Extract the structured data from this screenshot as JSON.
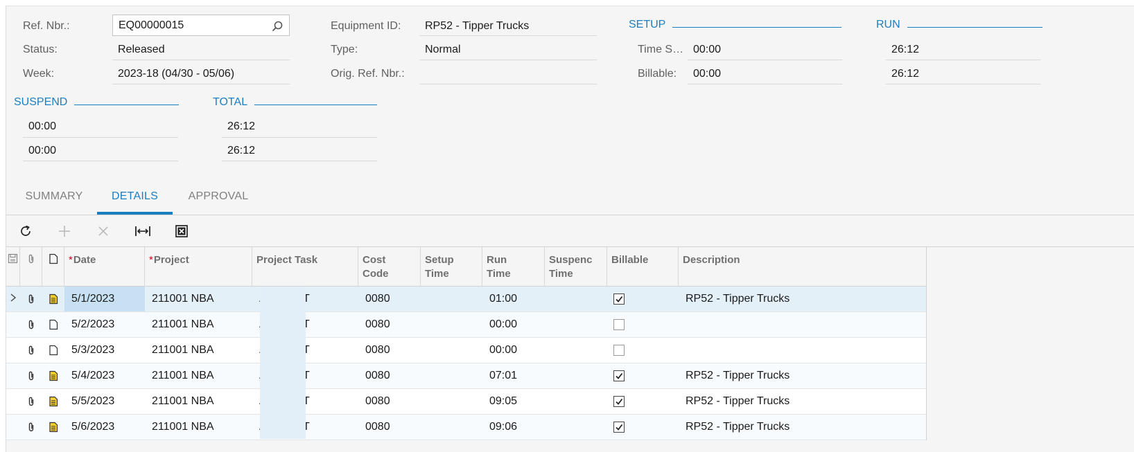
{
  "header": {
    "ref_nbr_label": "Ref. Nbr.:",
    "ref_nbr_value": "EQ00000015",
    "status_label": "Status:",
    "status_value": "Released",
    "week_label": "Week:",
    "week_value": "2023-18 (04/30 - 05/06)",
    "equipment_label": "Equipment ID:",
    "equipment_value": "RP52 - Tipper Trucks",
    "type_label": "Type:",
    "type_value": "Normal",
    "orig_ref_label": "Orig. Ref. Nbr.:",
    "orig_ref_value": ""
  },
  "setup": {
    "title": "SETUP",
    "time_label": "Time S…",
    "time_value": "00:00",
    "billable_label": "Billable:",
    "billable_value": "00:00"
  },
  "run": {
    "title": "RUN",
    "time_value": "26:12",
    "billable_value": "26:12"
  },
  "suspend": {
    "title": "SUSPEND",
    "time_value": "00:00",
    "billable_value": "00:00"
  },
  "total": {
    "title": "TOTAL",
    "time_value": "26:12",
    "billable_value": "26:12"
  },
  "tabs": [
    {
      "label": "SUMMARY",
      "active": false
    },
    {
      "label": "DETAILS",
      "active": true
    },
    {
      "label": "APPROVAL",
      "active": false
    }
  ],
  "toolbar": [
    "refresh-icon",
    "add-row-icon",
    "delete-row-icon",
    "fit-columns-icon",
    "export-excel-icon"
  ],
  "grid": {
    "columns": {
      "date": "Date",
      "project": "Project",
      "project_task": "Project Task",
      "cost_code": [
        "Cost",
        "Code"
      ],
      "setup_time": [
        "Setup",
        "Time"
      ],
      "run_time": [
        "Run",
        "Time"
      ],
      "suspend_time": [
        "Suspenc",
        "Time"
      ],
      "billable": "Billable",
      "description": "Description"
    },
    "rows": [
      {
        "date": "5/1/2023",
        "project": "211001 NBA",
        "task_start": "A",
        "task_end": "T",
        "cost_code": "0080",
        "setup": "",
        "run": "01:00",
        "suspend": "",
        "billable": true,
        "description": "RP52 - Tipper Trucks",
        "has_note": true
      },
      {
        "date": "5/2/2023",
        "project": "211001 NBA",
        "task_start": "A",
        "task_end": "T",
        "cost_code": "0080",
        "setup": "",
        "run": "00:00",
        "suspend": "",
        "billable": false,
        "description": "",
        "has_note": false
      },
      {
        "date": "5/3/2023",
        "project": "211001 NBA",
        "task_start": "A",
        "task_end": "T",
        "cost_code": "0080",
        "setup": "",
        "run": "00:00",
        "suspend": "",
        "billable": false,
        "description": "",
        "has_note": false
      },
      {
        "date": "5/4/2023",
        "project": "211001 NBA",
        "task_start": "A",
        "task_end": "T",
        "cost_code": "0080",
        "setup": "",
        "run": "07:01",
        "suspend": "",
        "billable": true,
        "description": "RP52 - Tipper Trucks",
        "has_note": true
      },
      {
        "date": "5/5/2023",
        "project": "211001 NBA",
        "task_start": "A",
        "task_end": "T",
        "cost_code": "0080",
        "setup": "",
        "run": "09:05",
        "suspend": "",
        "billable": true,
        "description": "RP52 - Tipper Trucks",
        "has_note": true
      },
      {
        "date": "5/6/2023",
        "project": "211001 NBA",
        "task_start": "A",
        "task_end": "T",
        "cost_code": "0080",
        "setup": "",
        "run": "09:06",
        "suspend": "",
        "billable": true,
        "description": "RP52 - Tipper Trucks",
        "has_note": true
      }
    ]
  },
  "colors": {
    "accent": "#1a7fc1",
    "note_yellow": "#e8c21a",
    "selected_row": "#e3f0f8"
  }
}
